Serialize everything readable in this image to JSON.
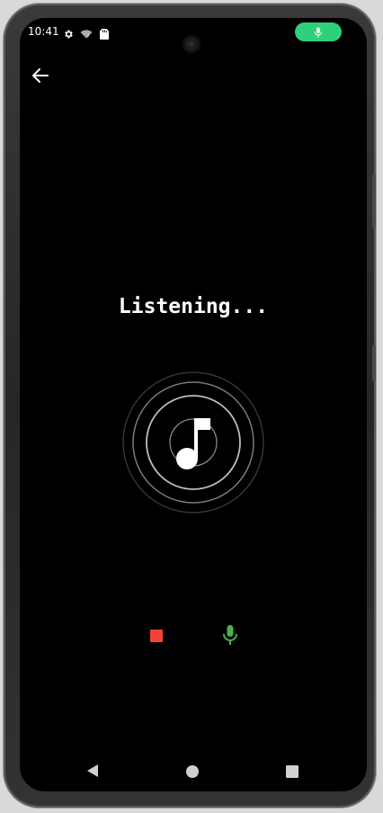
{
  "status_bar": {
    "time": "10:41",
    "icons": [
      "gear-icon",
      "wifi-icon",
      "sim-card-icon"
    ],
    "mic_indicator": "mic-icon",
    "mic_indicator_color": "#2fd07a"
  },
  "header": {
    "back_icon": "arrow-left-icon"
  },
  "main": {
    "title": "Listening...",
    "center_icon": "music-note-icon"
  },
  "controls": {
    "stop_icon": "stop-icon",
    "stop_color": "#f44336",
    "mic_icon": "mic-icon",
    "mic_color": "#4caf50"
  },
  "nav": {
    "back_icon": "triangle-back-icon",
    "home_icon": "circle-home-icon",
    "recents_icon": "square-recents-icon"
  }
}
